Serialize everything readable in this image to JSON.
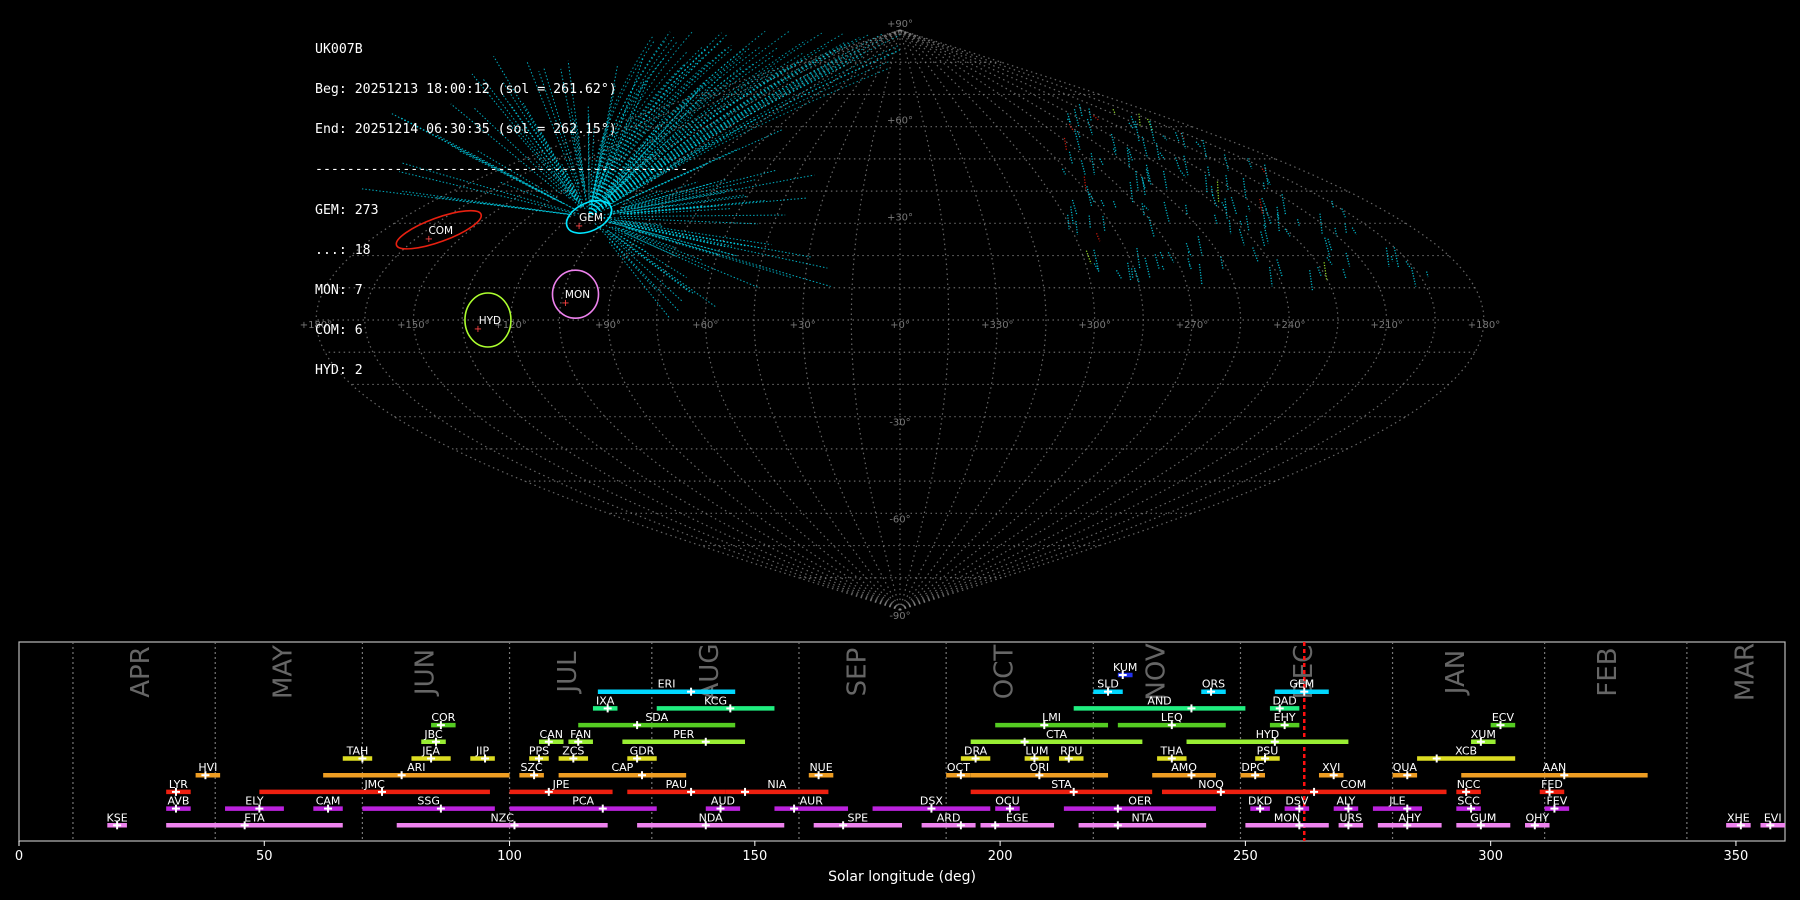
{
  "stats": {
    "station": "UK007B",
    "begin": "Beg: 20251213 18:00:12 (sol = 261.62°)",
    "end": "End: 20251214 06:30:35 (sol = 262.15°)",
    "separator": "-----------------------------------------------",
    "counts": [
      "GEM: 273",
      "...: 18",
      "MON: 7",
      "COM: 6",
      "HYD: 2"
    ]
  },
  "sky_map": {
    "projection": "sinusoidal",
    "lon_labels": [
      "+180°",
      "+150°",
      "+120°",
      "+90°",
      "+60°",
      "+30°",
      "+0°",
      "+330°",
      "+300°",
      "+270°",
      "+240°",
      "+210°",
      "+180°"
    ],
    "lat_labels": [
      "+90°",
      "+60°",
      "+30°",
      "-30°",
      "-60°",
      "-90°"
    ],
    "radiants": [
      {
        "code": "GEM",
        "lon": 113,
        "lat": 32,
        "color": "#00e5ff"
      },
      {
        "code": "COM",
        "lon": 161,
        "lat": 28,
        "color": "#e82010"
      },
      {
        "code": "MON",
        "lon": 101,
        "lat": 8,
        "color": "#ee82ee"
      },
      {
        "code": "HYD",
        "lon": 127,
        "lat": 0,
        "color": "#adff2f"
      }
    ],
    "trail_color": "#00d8f0",
    "grid_color": "#888888"
  },
  "chart_data": {
    "type": "bar",
    "title": "",
    "xlabel": "Solar longitude (deg)",
    "ylabel": "",
    "xlim": [
      0,
      360
    ],
    "xticks": [
      0,
      50,
      100,
      150,
      200,
      250,
      300,
      350
    ],
    "current_sol": 262,
    "months": [
      {
        "label": "APR",
        "start": 11,
        "center": 25
      },
      {
        "label": "MAY",
        "start": 40,
        "center": 54
      },
      {
        "label": "JUN",
        "start": 70,
        "center": 83
      },
      {
        "label": "JUL",
        "start": 100,
        "center": 112
      },
      {
        "label": "AUG",
        "start": 129,
        "center": 141
      },
      {
        "label": "SEP",
        "start": 159,
        "center": 171
      },
      {
        "label": "OCT",
        "start": 189,
        "center": 201
      },
      {
        "label": "NOV",
        "start": 219,
        "center": 232
      },
      {
        "label": "DEC",
        "start": 249,
        "center": 262
      },
      {
        "label": "JAN",
        "start": 280,
        "center": 293
      },
      {
        "label": "FEB",
        "start": 311,
        "center": 324
      },
      {
        "label": "MAR",
        "start": 340,
        "center": 352
      }
    ],
    "showers": [
      {
        "code": "KUM",
        "start": 224,
        "end": 227,
        "peak": 225,
        "row": 10,
        "color": "#2233ee"
      },
      {
        "code": "ERI",
        "start": 118,
        "end": 146,
        "peak": 137,
        "row": 9,
        "color": "#00d8ff"
      },
      {
        "code": "SLD",
        "start": 219,
        "end": 225,
        "peak": 222,
        "row": 9,
        "color": "#00d8ff"
      },
      {
        "code": "ORS",
        "start": 241,
        "end": 246,
        "peak": 243,
        "row": 9,
        "color": "#00d8ff"
      },
      {
        "code": "GEM",
        "start": 256,
        "end": 267,
        "peak": 262,
        "row": 9,
        "color": "#00d8ff"
      },
      {
        "code": "IXA",
        "start": 117,
        "end": 122,
        "peak": 120,
        "row": 8,
        "color": "#20ee80"
      },
      {
        "code": "KCG",
        "start": 130,
        "end": 154,
        "peak": 145,
        "row": 8,
        "color": "#20ee80"
      },
      {
        "code": "AND",
        "start": 215,
        "end": 250,
        "peak": 239,
        "row": 8,
        "color": "#20ee80"
      },
      {
        "code": "DAD",
        "start": 255,
        "end": 261,
        "peak": 257,
        "row": 8,
        "color": "#20ee80"
      },
      {
        "code": "COR",
        "start": 84,
        "end": 89,
        "peak": 86,
        "row": 7,
        "color": "#55cc22"
      },
      {
        "code": "SDA",
        "start": 114,
        "end": 146,
        "peak": 126,
        "row": 7,
        "color": "#55cc22"
      },
      {
        "code": "LMI",
        "start": 199,
        "end": 222,
        "peak": 209,
        "row": 7,
        "color": "#55cc22"
      },
      {
        "code": "LEQ",
        "start": 224,
        "end": 246,
        "peak": 235,
        "row": 7,
        "color": "#55cc22"
      },
      {
        "code": "EHY",
        "start": 255,
        "end": 261,
        "peak": 258,
        "row": 7,
        "color": "#55cc22"
      },
      {
        "code": "ECV",
        "start": 300,
        "end": 305,
        "peak": 302,
        "row": 7,
        "color": "#55cc22"
      },
      {
        "code": "JBC",
        "start": 82,
        "end": 87,
        "peak": 85,
        "row": 6,
        "color": "#99ee33"
      },
      {
        "code": "CAN",
        "start": 106,
        "end": 111,
        "peak": 108,
        "row": 6,
        "color": "#99ee33"
      },
      {
        "code": "FAN",
        "start": 112,
        "end": 117,
        "peak": 114,
        "row": 6,
        "color": "#99ee33"
      },
      {
        "code": "PER",
        "start": 123,
        "end": 148,
        "peak": 140,
        "row": 6,
        "color": "#99ee33"
      },
      {
        "code": "CTA",
        "start": 194,
        "end": 229,
        "peak": 205,
        "row": 6,
        "color": "#99ee33"
      },
      {
        "code": "HYD",
        "start": 238,
        "end": 271,
        "peak": 256,
        "row": 6,
        "color": "#99ee33"
      },
      {
        "code": "XUM",
        "start": 296,
        "end": 301,
        "peak": 298,
        "row": 6,
        "color": "#99ee33"
      },
      {
        "code": "TAH",
        "start": 66,
        "end": 72,
        "peak": 70,
        "row": 5,
        "color": "#dddd22"
      },
      {
        "code": "JEA",
        "start": 80,
        "end": 88,
        "peak": 84,
        "row": 5,
        "color": "#dddd22"
      },
      {
        "code": "JIP",
        "start": 92,
        "end": 97,
        "peak": 95,
        "row": 5,
        "color": "#dddd22"
      },
      {
        "code": "PPS",
        "start": 104,
        "end": 108,
        "peak": 106,
        "row": 5,
        "color": "#dddd22"
      },
      {
        "code": "ZCS",
        "start": 110,
        "end": 116,
        "peak": 113,
        "row": 5,
        "color": "#dddd22"
      },
      {
        "code": "GDR",
        "start": 124,
        "end": 130,
        "peak": 126,
        "row": 5,
        "color": "#dddd22"
      },
      {
        "code": "DRA",
        "start": 192,
        "end": 198,
        "peak": 195,
        "row": 5,
        "color": "#dddd22"
      },
      {
        "code": "LUM",
        "start": 205,
        "end": 210,
        "peak": 207,
        "row": 5,
        "color": "#dddd22"
      },
      {
        "code": "RPU",
        "start": 212,
        "end": 217,
        "peak": 214,
        "row": 5,
        "color": "#dddd22"
      },
      {
        "code": "THA",
        "start": 232,
        "end": 238,
        "peak": 235,
        "row": 5,
        "color": "#dddd22"
      },
      {
        "code": "PSU",
        "start": 252,
        "end": 257,
        "peak": 254,
        "row": 5,
        "color": "#dddd22"
      },
      {
        "code": "XCB",
        "start": 285,
        "end": 305,
        "peak": 289,
        "row": 5,
        "color": "#dddd22"
      },
      {
        "code": "HVI",
        "start": 36,
        "end": 41,
        "peak": 38,
        "row": 4,
        "color": "#ee9d22"
      },
      {
        "code": "ARI",
        "start": 62,
        "end": 100,
        "peak": 78,
        "row": 4,
        "color": "#ee9d22"
      },
      {
        "code": "SZC",
        "start": 102,
        "end": 107,
        "peak": 105,
        "row": 4,
        "color": "#ee9d22"
      },
      {
        "code": "CAP",
        "start": 110,
        "end": 136,
        "peak": 127,
        "row": 4,
        "color": "#ee9d22"
      },
      {
        "code": "NUE",
        "start": 161,
        "end": 166,
        "peak": 163,
        "row": 4,
        "color": "#ee9d22"
      },
      {
        "code": "OCT",
        "start": 189,
        "end": 194,
        "peak": 192,
        "row": 4,
        "color": "#ee9d22"
      },
      {
        "code": "ORI",
        "start": 194,
        "end": 222,
        "peak": 208,
        "row": 4,
        "color": "#ee9d22"
      },
      {
        "code": "AMO",
        "start": 231,
        "end": 244,
        "peak": 239,
        "row": 4,
        "color": "#ee9d22"
      },
      {
        "code": "DPC",
        "start": 249,
        "end": 254,
        "peak": 252,
        "row": 4,
        "color": "#ee9d22"
      },
      {
        "code": "XVI",
        "start": 265,
        "end": 270,
        "peak": 268,
        "row": 4,
        "color": "#ee9d22"
      },
      {
        "code": "QUA",
        "start": 280,
        "end": 285,
        "peak": 283,
        "row": 4,
        "color": "#ee9d22"
      },
      {
        "code": "AAN",
        "start": 294,
        "end": 332,
        "peak": 315,
        "row": 4,
        "color": "#ee9d22"
      },
      {
        "code": "LYR",
        "start": 30,
        "end": 35,
        "peak": 32,
        "row": 3,
        "color": "#ee2010"
      },
      {
        "code": "JMC",
        "start": 49,
        "end": 96,
        "peak": 74,
        "row": 3,
        "color": "#ee2010"
      },
      {
        "code": "JPE",
        "start": 100,
        "end": 121,
        "peak": 108,
        "row": 3,
        "color": "#ee2010"
      },
      {
        "code": "PAU",
        "start": 124,
        "end": 144,
        "peak": 137,
        "row": 3,
        "color": "#ee2010"
      },
      {
        "code": "NIA",
        "start": 144,
        "end": 165,
        "peak": 148,
        "row": 3,
        "color": "#ee2010"
      },
      {
        "code": "STA",
        "start": 194,
        "end": 231,
        "peak": 215,
        "row": 3,
        "color": "#ee2010"
      },
      {
        "code": "NOO",
        "start": 233,
        "end": 253,
        "peak": 245,
        "row": 3,
        "color": "#ee2010"
      },
      {
        "code": "COM",
        "start": 253,
        "end": 291,
        "peak": 264,
        "row": 3,
        "color": "#ee2010"
      },
      {
        "code": "NCC",
        "start": 293,
        "end": 298,
        "peak": 295,
        "row": 3,
        "color": "#ee2010"
      },
      {
        "code": "FED",
        "start": 310,
        "end": 315,
        "peak": 312,
        "row": 3,
        "color": "#ee2010"
      },
      {
        "code": "AVB",
        "start": 30,
        "end": 35,
        "peak": 32,
        "row": 2,
        "color": "#bb22dd"
      },
      {
        "code": "ELY",
        "start": 42,
        "end": 54,
        "peak": 49,
        "row": 2,
        "color": "#bb22dd"
      },
      {
        "code": "CAM",
        "start": 60,
        "end": 66,
        "peak": 63,
        "row": 2,
        "color": "#bb22dd"
      },
      {
        "code": "SSG",
        "start": 70,
        "end": 97,
        "peak": 86,
        "row": 2,
        "color": "#bb22dd"
      },
      {
        "code": "PCA",
        "start": 100,
        "end": 130,
        "peak": 119,
        "row": 2,
        "color": "#bb22dd"
      },
      {
        "code": "AUD",
        "start": 140,
        "end": 147,
        "peak": 143,
        "row": 2,
        "color": "#bb22dd"
      },
      {
        "code": "AUR",
        "start": 154,
        "end": 169,
        "peak": 158,
        "row": 2,
        "color": "#bb22dd"
      },
      {
        "code": "DSX",
        "start": 174,
        "end": 198,
        "peak": 186,
        "row": 2,
        "color": "#bb22dd"
      },
      {
        "code": "OCU",
        "start": 199,
        "end": 204,
        "peak": 202,
        "row": 2,
        "color": "#bb22dd"
      },
      {
        "code": "OER",
        "start": 213,
        "end": 244,
        "peak": 224,
        "row": 2,
        "color": "#bb22dd"
      },
      {
        "code": "DKD",
        "start": 251,
        "end": 255,
        "peak": 253,
        "row": 2,
        "color": "#bb22dd"
      },
      {
        "code": "DSV",
        "start": 258,
        "end": 263,
        "peak": 261,
        "row": 2,
        "color": "#bb22dd"
      },
      {
        "code": "ALY",
        "start": 268,
        "end": 273,
        "peak": 271,
        "row": 2,
        "color": "#bb22dd"
      },
      {
        "code": "JLE",
        "start": 276,
        "end": 286,
        "peak": 283,
        "row": 2,
        "color": "#bb22dd"
      },
      {
        "code": "SCC",
        "start": 293,
        "end": 298,
        "peak": 296,
        "row": 2,
        "color": "#bb22dd"
      },
      {
        "code": "FEV",
        "start": 311,
        "end": 316,
        "peak": 313,
        "row": 2,
        "color": "#bb22dd"
      },
      {
        "code": "KSE",
        "start": 18,
        "end": 22,
        "peak": 20,
        "row": 1,
        "color": "#ee82ee"
      },
      {
        "code": "ETA",
        "start": 30,
        "end": 66,
        "peak": 46,
        "row": 1,
        "color": "#ee82ee"
      },
      {
        "code": "NZC",
        "start": 77,
        "end": 120,
        "peak": 101,
        "row": 1,
        "color": "#ee82ee"
      },
      {
        "code": "NDA",
        "start": 126,
        "end": 156,
        "peak": 140,
        "row": 1,
        "color": "#ee82ee"
      },
      {
        "code": "SPE",
        "start": 162,
        "end": 180,
        "peak": 168,
        "row": 1,
        "color": "#ee82ee"
      },
      {
        "code": "ARD",
        "start": 184,
        "end": 195,
        "peak": 192,
        "row": 1,
        "color": "#ee82ee"
      },
      {
        "code": "EGE",
        "start": 196,
        "end": 211,
        "peak": 199,
        "row": 1,
        "color": "#ee82ee"
      },
      {
        "code": "NTA",
        "start": 216,
        "end": 242,
        "peak": 224,
        "row": 1,
        "color": "#ee82ee"
      },
      {
        "code": "MON",
        "start": 250,
        "end": 267,
        "peak": 261,
        "row": 1,
        "color": "#ee82ee"
      },
      {
        "code": "URS",
        "start": 269,
        "end": 274,
        "peak": 271,
        "row": 1,
        "color": "#ee82ee"
      },
      {
        "code": "AHY",
        "start": 277,
        "end": 290,
        "peak": 283,
        "row": 1,
        "color": "#ee82ee"
      },
      {
        "code": "GUM",
        "start": 293,
        "end": 304,
        "peak": 298,
        "row": 1,
        "color": "#ee82ee"
      },
      {
        "code": "OHY",
        "start": 307,
        "end": 312,
        "peak": 309,
        "row": 1,
        "color": "#ee82ee"
      },
      {
        "code": "XHE",
        "start": 348,
        "end": 353,
        "peak": 351,
        "row": 1,
        "color": "#ee82ee"
      },
      {
        "code": "EVI",
        "start": 355,
        "end": 360,
        "peak": 357,
        "row": 1,
        "color": "#ee82ee"
      }
    ]
  }
}
